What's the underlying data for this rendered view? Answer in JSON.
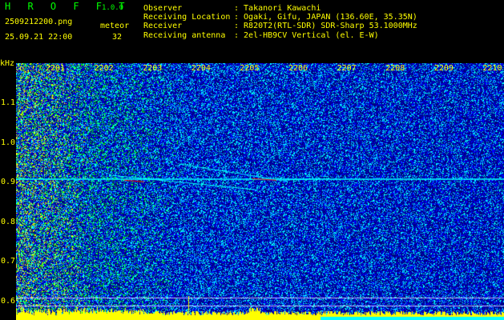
{
  "header": {
    "app_title": "H R O F F T",
    "app_version": "1.0.0",
    "filename": "2509212200.png",
    "mode": "meteor",
    "datetime": "25.09.21 22:00",
    "count": "32",
    "info": [
      {
        "label": "Observer",
        "value": ": Takanori Kawachi"
      },
      {
        "label": "Receiving Location",
        "value": ": Ogaki, Gifu, JAPAN (136.60E, 35.35N)"
      },
      {
        "label": "Receiver",
        "value": ": R820T2(RTL-SDR) SDR-Sharp 53.1000MHz"
      },
      {
        "label": "Receiving antenna",
        "value": ": 2el-HB9CV Vertical (el. E-W)"
      }
    ]
  },
  "spectrogram": {
    "y_unit": "kHz",
    "x_ticks": [
      "2201",
      "2202",
      "2203",
      "2204",
      "2205",
      "2206",
      "2207",
      "2208",
      "2209",
      "2210"
    ],
    "y_ticks": [
      "1.1",
      "1.0",
      "0.9",
      "0.8",
      "0.7",
      "0.6"
    ],
    "y_range_khz": [
      0.57,
      1.2
    ],
    "carrier_khz": 0.91,
    "colors": {
      "background": "#000080",
      "noise_low": "#0000ff",
      "noise_mid": "#00ffff",
      "noise_high": "#00ff00",
      "strong": "#ffff00",
      "echo": "#ff0000",
      "grid_line": "#c0c0ff"
    }
  }
}
